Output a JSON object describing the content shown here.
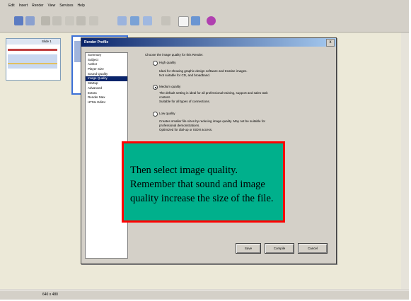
{
  "menubar": {
    "items": [
      "Edit",
      "Insert",
      "Render",
      "View",
      "Services",
      "Help"
    ]
  },
  "dialog": {
    "title": "Render Profile",
    "close_label": "x",
    "nav_items": [
      "Summary",
      "Subject",
      "Author",
      "Player Size",
      "Sound Quality",
      "Image Quality",
      "Startup",
      "Advanced",
      "Extras",
      "Render Max",
      "HTML Editor"
    ],
    "selected_nav": "Image Quality",
    "intro": "Choose the image quality for this Render.",
    "options": [
      {
        "label": "High quality",
        "desc": [
          "Ideal for showing graphic design software and treatise images.",
          "Not suitable for CD, and broadband."
        ],
        "selected": false
      },
      {
        "label": "Medium quality",
        "desc": [
          "The default setting is ideal for all professional training, support and sales task",
          "content.",
          "Suitable for all types of connections."
        ],
        "selected": true
      },
      {
        "label": "Low quality",
        "desc": [
          "Creates smaller file sizes by reducing image quality. May not be suitable for",
          "professional demonstrations.",
          "Optimized for dial-up or ISDN access."
        ],
        "selected": false
      }
    ],
    "buttons": {
      "save": "Save",
      "compile": "Compile",
      "cancel": "Cancel"
    }
  },
  "thumbnail": {
    "label": "Slide 1"
  },
  "status": {
    "size": "640 x 480"
  },
  "callout": {
    "text": "Then select image quality. Remember that sound and image quality increase the size of the file."
  },
  "colors": {
    "callout_fill": "#00b08c",
    "callout_border": "#ff0000",
    "title_bar": "#0a246a"
  }
}
